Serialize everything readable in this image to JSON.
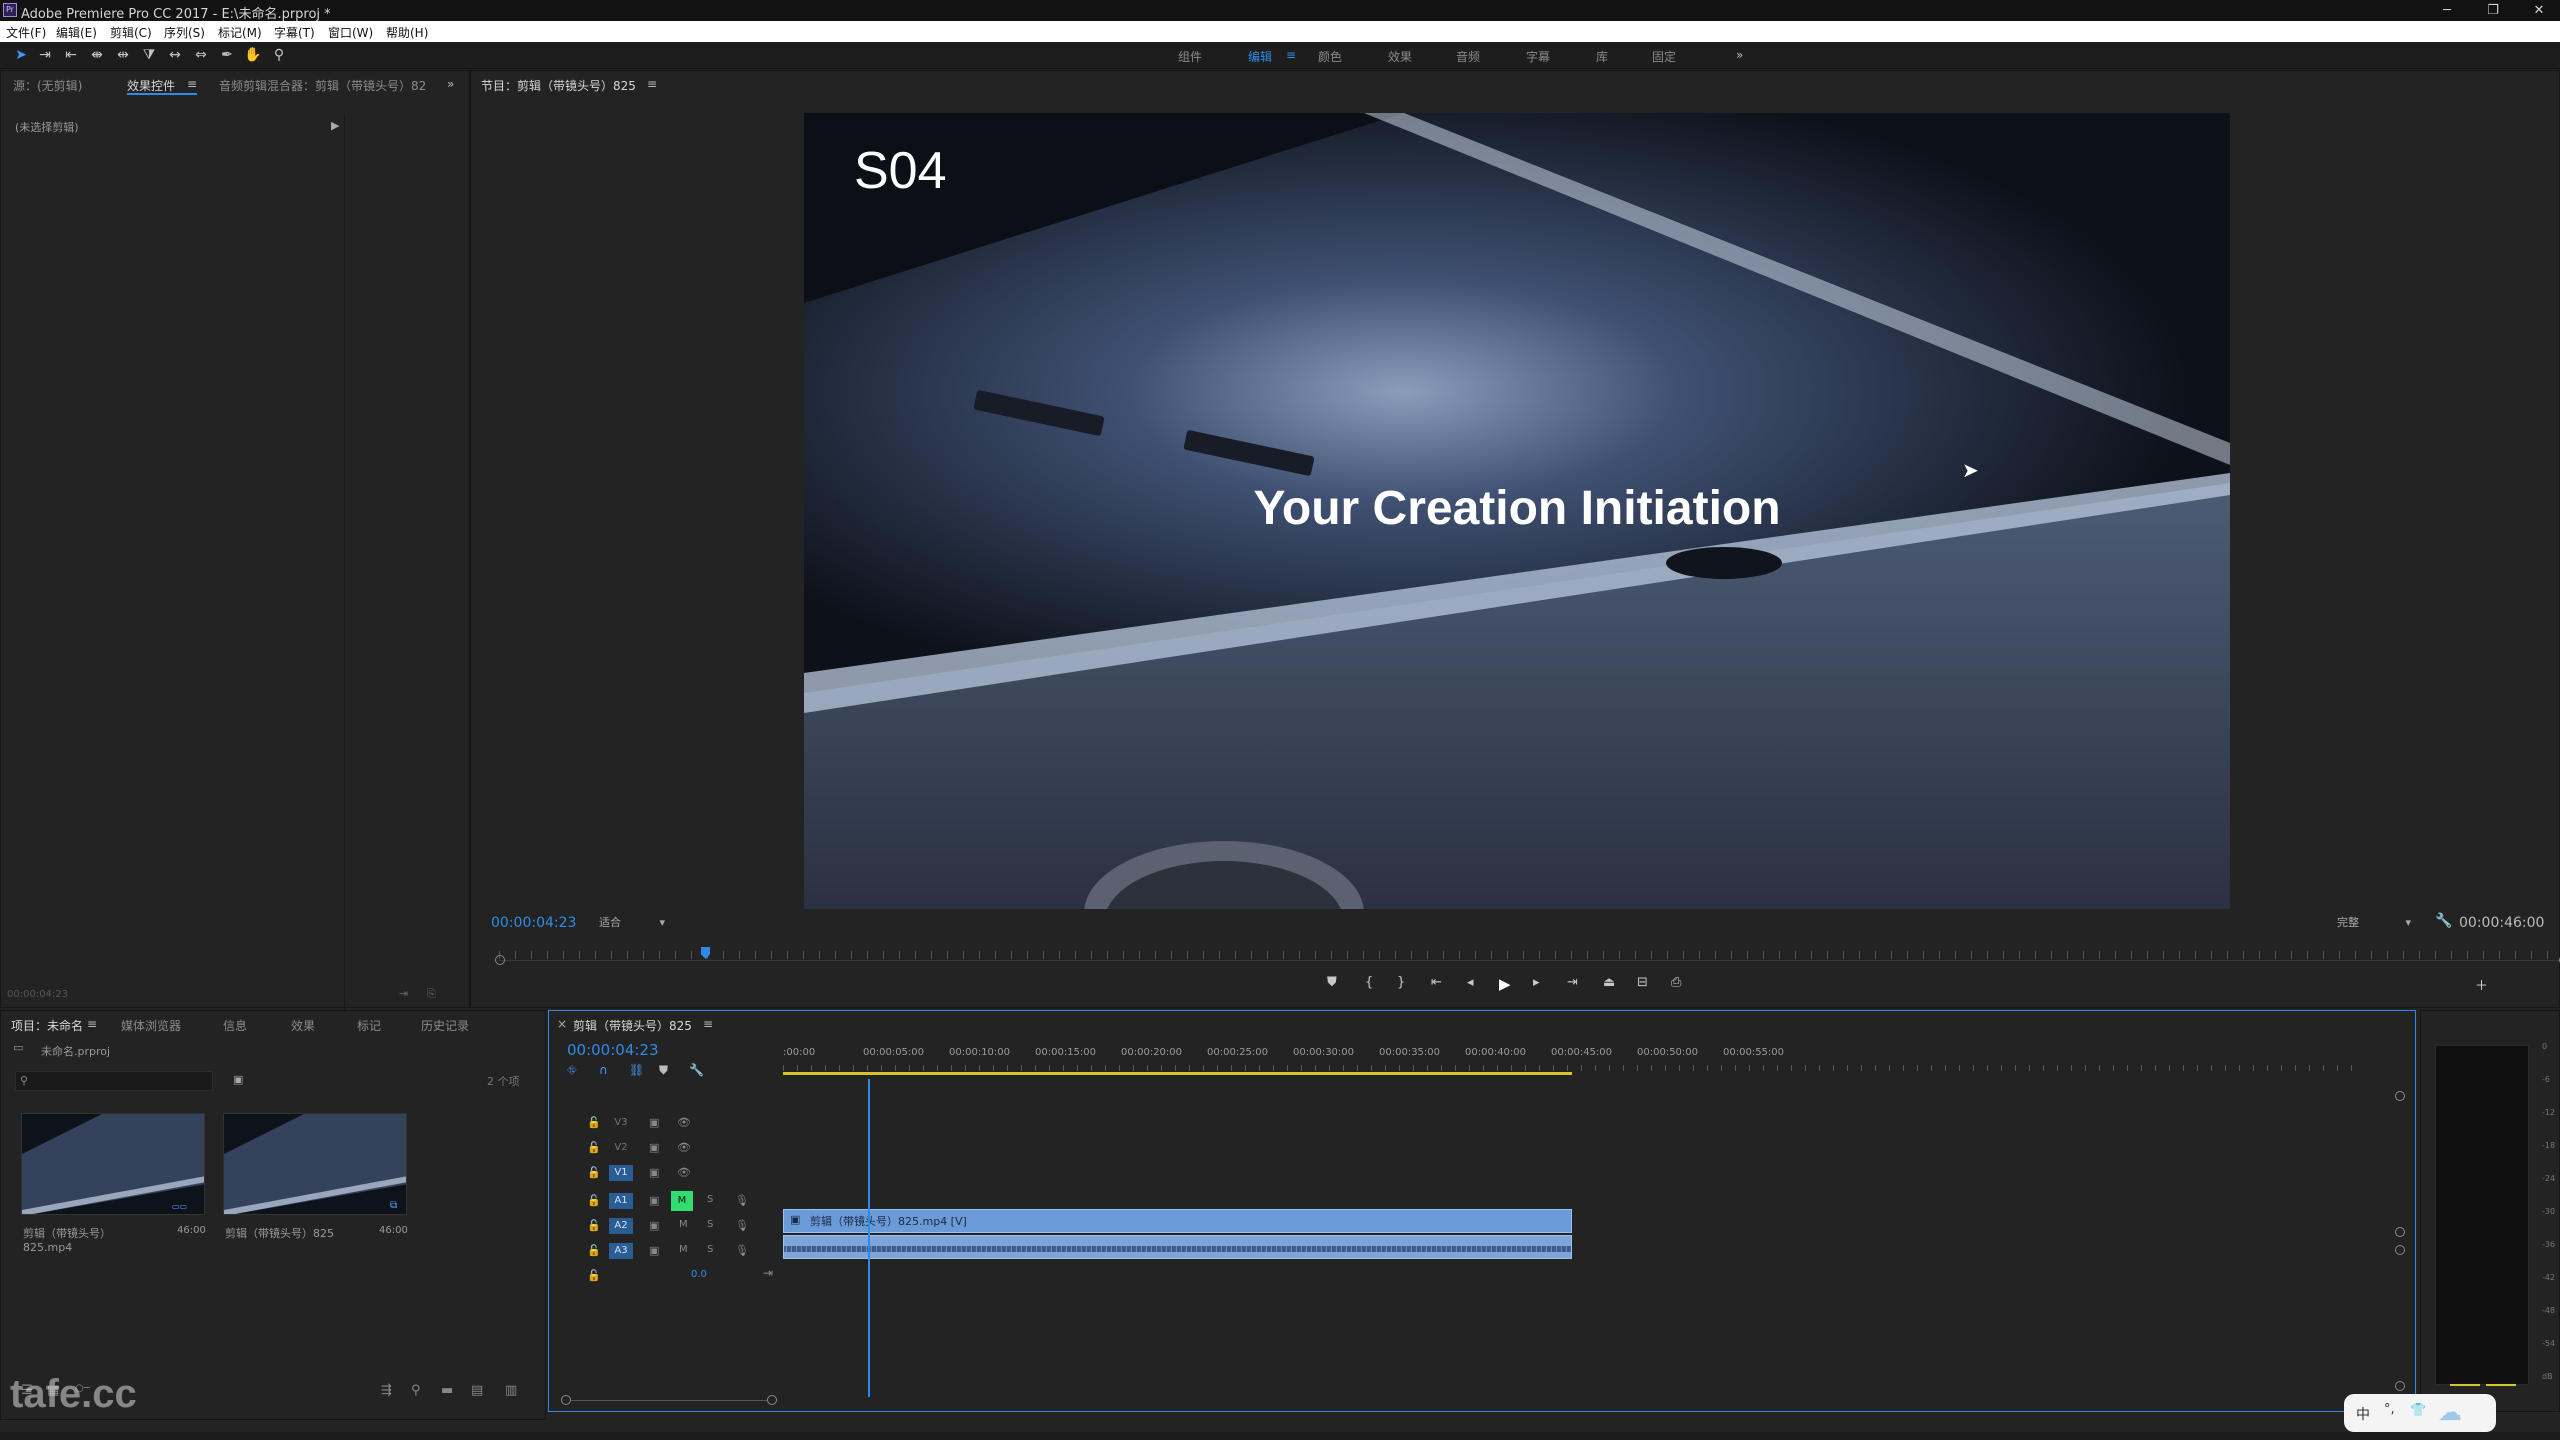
{
  "window": {
    "title": "Adobe Premiere Pro CC 2017 - E:\\未命名.prproj *",
    "icon": "premiere-app-icon"
  },
  "menus": [
    "文件(F)",
    "编辑(E)",
    "剪辑(C)",
    "序列(S)",
    "标记(M)",
    "字幕(T)",
    "窗口(W)",
    "帮助(H)"
  ],
  "workspaces": [
    "组件",
    "编辑",
    "颜色",
    "效果",
    "音频",
    "字幕",
    "库",
    "固定"
  ],
  "workspace_active": "编辑",
  "source_panel": {
    "tabs": [
      "源：(无剪辑)",
      "效果控件",
      "音频剪辑混合器：剪辑（带镜头号）82"
    ],
    "empty_label": "(未选择剪辑)",
    "timecode": "00:00:04:23"
  },
  "program_monitor": {
    "tab": "节目：剪辑（带镜头号）825",
    "overlay_tag": "S04",
    "overlay_text": "Your Creation Initiation",
    "timecode": "00:00:04:23",
    "fit": "适合",
    "quality": "完整",
    "duration": "00:00:46:00",
    "playhead": 0.1
  },
  "project_panel": {
    "tabs": [
      "项目：未命名",
      "媒体浏览器",
      "信息",
      "效果",
      "标记",
      "历史记录"
    ],
    "project_file": "未命名.prproj",
    "item_count": "2 个项",
    "items": [
      {
        "name": "剪辑（带镜头号）825.mp4",
        "duration": "46:00"
      },
      {
        "name": "剪辑（带镜头号）825",
        "duration": "46:00"
      }
    ]
  },
  "timeline": {
    "tab": "剪辑（带镜头号）825",
    "timecode": "00:00:04:23",
    "ruler": [
      ":00:00",
      "00:00:05:00",
      "00:00:10:00",
      "00:00:15:00",
      "00:00:20:00",
      "00:00:25:00",
      "00:00:30:00",
      "00:00:35:00",
      "00:00:40:00",
      "00:00:45:00",
      "00:00:50:00",
      "00:00:55:00"
    ],
    "video_tracks": [
      "V3",
      "V2",
      "V1"
    ],
    "audio_tracks": [
      "A1",
      "A2",
      "A3"
    ],
    "master_volume": "0.0",
    "clip_label": "剪辑（带镜头号）825.mp4 [V]",
    "clip_end_seconds": 46,
    "playhead_seconds": 4.96
  },
  "meters": {
    "scale": [
      "0",
      "-6",
      "-12",
      "-18",
      "-24",
      "-30",
      "-36",
      "-42",
      "-48",
      "-54",
      "dB"
    ]
  },
  "status": {
    "ime": "中"
  },
  "watermark": "tafe.cc",
  "colors": {
    "accent": "#2d8ceb",
    "clip": "#6a9ad8",
    "audio_clip": "#7ea4d8",
    "work_area": "#d7c32a",
    "mute_active": "#2fdd72"
  }
}
